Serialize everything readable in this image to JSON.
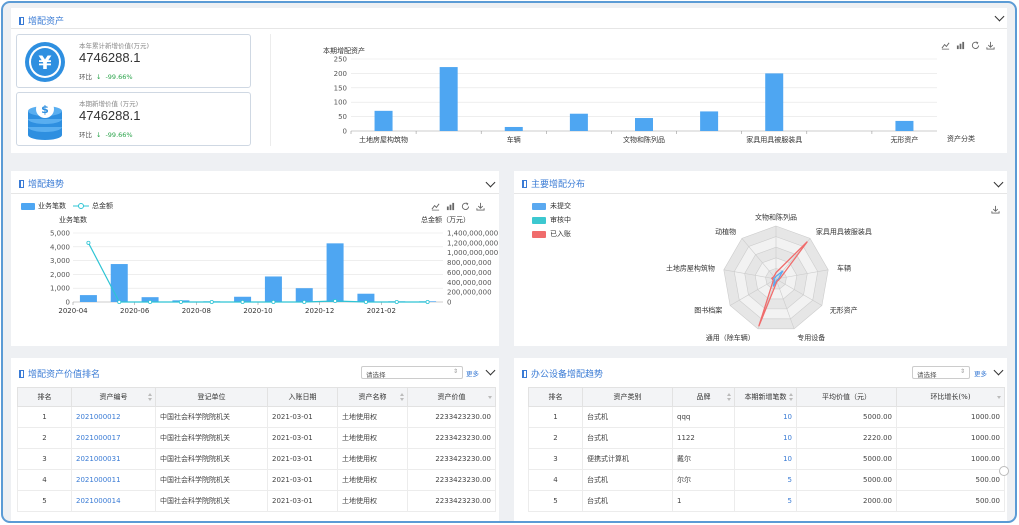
{
  "top_panel": {
    "title": "增配资产",
    "cards": [
      {
        "label": "本年累计新增价值(万元)",
        "value": "4746288.1",
        "change_label": "环比",
        "change_arrow": "↓",
        "change_value": "-99.66%"
      },
      {
        "label": "本期新增价值 (万元)",
        "value": "4746288.1",
        "change_label": "环比",
        "change_arrow": "↓",
        "change_value": "-99.66%"
      }
    ],
    "icons": [
      "yen-coin-icon",
      "coin-stack-icon"
    ]
  },
  "asset_chart": {
    "series_label": "本期增配资产",
    "x_axis_title": "资产分类",
    "tick_labels_shown": [
      "土地房屋构筑物",
      "车辆",
      "文物和陈列品",
      "家具用具被服装具",
      "无形资产"
    ],
    "y_ticks": [
      "250",
      "200",
      "150",
      "100",
      "50",
      "0"
    ]
  },
  "trend_panel": {
    "title": "增配趋势",
    "legend": [
      {
        "label": "业务笔数"
      },
      {
        "label": "总金额"
      }
    ],
    "left_axis_title": "业务笔数",
    "right_axis_title": "总金额（万元）",
    "left_ticks": [
      "5,000",
      "4,000",
      "3,000",
      "2,000",
      "1,000",
      "0"
    ],
    "right_ticks": [
      "1,400,000,000",
      "1,200,000,000",
      "1,000,000,000",
      "800,000,000",
      "600,000,000",
      "400,000,000",
      "200,000,000",
      "0"
    ],
    "x_ticks": [
      "2020-04",
      "2020-06",
      "2020-08",
      "2020-10",
      "2020-12",
      "2021-02"
    ]
  },
  "dist_panel": {
    "title": "主要增配分布",
    "legend": [
      {
        "label": "未提交",
        "color": "#5aa9f0"
      },
      {
        "label": "审核中",
        "color": "#3cc8d0"
      },
      {
        "label": "已入账",
        "color": "#f06c6c"
      }
    ],
    "axes": [
      "文物和陈列品",
      "家具用具被服装具",
      "车辆",
      "无形资产",
      "专用设备",
      "通用（除车辆）",
      "图书档案",
      "土地房屋构筑物",
      "动植物"
    ]
  },
  "rank_panel": {
    "title": "增配资产价值排名",
    "select_placeholder": "请选择",
    "more": "更多",
    "columns": [
      "排名",
      "资产编号",
      "登记单位",
      "入账日期",
      "资产名称",
      "资产价值"
    ],
    "rows": [
      [
        "1",
        "2021000012",
        "中国社会科学院院机关",
        "2021-03-01",
        "土地使用权",
        "2233423230.00"
      ],
      [
        "2",
        "2021000017",
        "中国社会科学院院机关",
        "2021-03-01",
        "土地使用权",
        "2233423230.00"
      ],
      [
        "3",
        "2021000031",
        "中国社会科学院院机关",
        "2021-03-01",
        "土地使用权",
        "2233423230.00"
      ],
      [
        "4",
        "2021000011",
        "中国社会科学院院机关",
        "2021-03-01",
        "土地使用权",
        "2233423230.00"
      ],
      [
        "5",
        "2021000014",
        "中国社会科学院院机关",
        "2021-03-01",
        "土地使用权",
        "2233423230.00"
      ]
    ]
  },
  "office_panel": {
    "title": "办公设备增配趋势",
    "select_placeholder": "请选择",
    "more": "更多",
    "columns": [
      "排名",
      "资产类别",
      "品牌",
      "本期新增笔数",
      "平均价值（元）",
      "环比增长(%)"
    ],
    "rows": [
      [
        "1",
        "台式机",
        "qqq",
        "10",
        "5000.00",
        "1000.00"
      ],
      [
        "2",
        "台式机",
        "1122",
        "10",
        "2220.00",
        "1000.00"
      ],
      [
        "3",
        "便携式计算机",
        "戴尔",
        "10",
        "5000.00",
        "1000.00"
      ],
      [
        "4",
        "台式机",
        "尔尔",
        "5",
        "5000.00",
        "500.00"
      ],
      [
        "5",
        "台式机",
        "1",
        "5",
        "2000.00",
        "500.00"
      ]
    ]
  },
  "chart_data": [
    {
      "type": "bar",
      "title": "",
      "legend": "本期增配资产",
      "xlabel": "资产分类",
      "ylabel": "",
      "ylim": [
        0,
        250
      ],
      "categories": [
        "土地房屋构筑物",
        "",
        "车辆",
        "",
        "文物和陈列品",
        "",
        "家具用具被服装具",
        "",
        "无形资产"
      ],
      "values": [
        70,
        222,
        14,
        60,
        45,
        68,
        200,
        0,
        35
      ],
      "color": "#4ea6f2"
    },
    {
      "type": "bar",
      "title": "",
      "categories": [
        "2020-04",
        "2020-05",
        "2020-06",
        "2020-07",
        "2020-08",
        "2020-09",
        "2020-10",
        "2020-11",
        "2020-12",
        "2021-01",
        "2021-02",
        "2021-03"
      ],
      "series": [
        {
          "name": "业务笔数",
          "type": "bar",
          "axis": "left",
          "values": [
            500,
            2750,
            350,
            120,
            50,
            380,
            1850,
            1000,
            4250,
            600,
            50,
            50
          ],
          "color": "#4ea6f2"
        },
        {
          "name": "总金额",
          "type": "line",
          "axis": "right",
          "values": [
            1200000000,
            0,
            0,
            0,
            0,
            0,
            0,
            0,
            20000000,
            0,
            0,
            0
          ],
          "color": "#2ec4d4"
        }
      ],
      "ylim_left": [
        0,
        5000
      ],
      "ylim_right": [
        0,
        1400000000
      ]
    },
    {
      "type": "radar",
      "axes": [
        "文物和陈列品",
        "家具用具被服装具",
        "车辆",
        "无形资产",
        "专用设备",
        "通用（除车辆）",
        "图书档案",
        "土地房屋构筑物",
        "动植物"
      ],
      "series": [
        {
          "name": "已入账",
          "values": [
            0.12,
            0.92,
            0.08,
            0.05,
            0.05,
            0.95,
            0.06,
            0.08,
            0.06
          ],
          "color": "#f06c6c"
        },
        {
          "name": "未提交",
          "values": [
            0.05,
            0.2,
            0.05,
            0.03,
            0.03,
            0.15,
            0.03,
            0.05,
            0.03
          ],
          "color": "#5aa9f0"
        }
      ]
    }
  ]
}
